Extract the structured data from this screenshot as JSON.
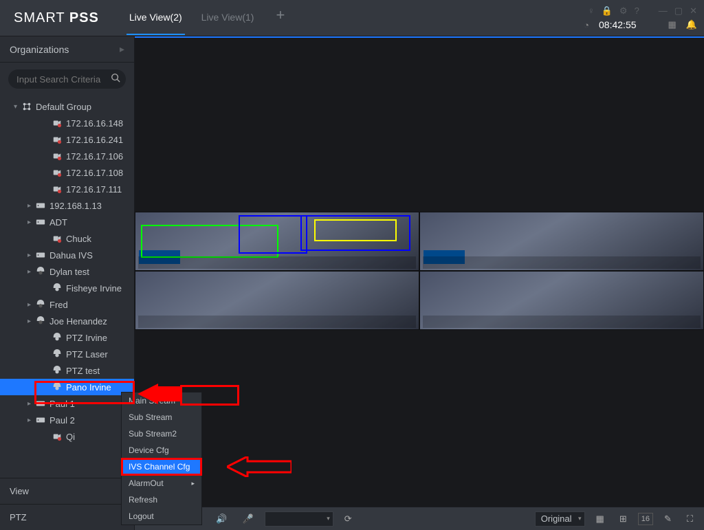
{
  "brand": {
    "part1": "SMART ",
    "part2": "PSS"
  },
  "tabs": [
    {
      "label": "Live View(2)",
      "active": true
    },
    {
      "label": "Live View(1)",
      "active": false
    }
  ],
  "clock": "08:42:55",
  "sidebar": {
    "header": "Organizations",
    "search_placeholder": "Input Search Criteria",
    "root": {
      "label": "Default Group"
    },
    "devices": [
      {
        "label": "172.16.16.148",
        "type": "cam",
        "offline": true
      },
      {
        "label": "172.16.16.241",
        "type": "cam",
        "offline": true
      },
      {
        "label": "172.16.17.106",
        "type": "cam",
        "offline": true
      },
      {
        "label": "172.16.17.108",
        "type": "cam",
        "offline": true
      },
      {
        "label": "172.16.17.111",
        "type": "cam",
        "offline": true
      },
      {
        "label": "192.168.1.13",
        "type": "nvr",
        "expandable": true
      },
      {
        "label": "ADT",
        "type": "nvr",
        "expandable": true
      },
      {
        "label": "Chuck",
        "type": "cam",
        "offline": true
      },
      {
        "label": "Dahua IVS",
        "type": "nvr",
        "expandable": true
      },
      {
        "label": "Dylan test",
        "type": "dome",
        "expandable": true
      },
      {
        "label": "Fisheye Irvine",
        "type": "dome-on"
      },
      {
        "label": "Fred",
        "type": "dome",
        "expandable": true
      },
      {
        "label": "Joe Henandez",
        "type": "dome",
        "expandable": true
      },
      {
        "label": "PTZ Irvine",
        "type": "dome-on"
      },
      {
        "label": "PTZ Laser",
        "type": "dome-on"
      },
      {
        "label": "PTZ test",
        "type": "dome-on"
      },
      {
        "label": "Pano Irvine",
        "type": "dome-on",
        "selected": true
      },
      {
        "label": "Paul 1",
        "type": "nvr",
        "expandable": true
      },
      {
        "label": "Paul 2",
        "type": "nvr",
        "expandable": true
      },
      {
        "label": "Qi",
        "type": "cam",
        "offline": true
      }
    ],
    "bottom": [
      "View",
      "PTZ"
    ]
  },
  "context_menu": [
    "Main Stream",
    "Sub Stream",
    "Sub Stream2",
    "Device Cfg",
    "IVS Channel Cfg",
    "AlarmOut",
    "Refresh",
    "Logout"
  ],
  "context_selected_index": 4,
  "toolbar": {
    "scale_label": "Original",
    "grid16_label": "16"
  }
}
